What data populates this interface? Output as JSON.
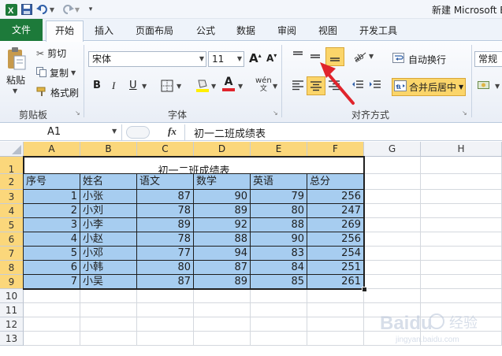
{
  "window": {
    "title": "新建 Microsoft E"
  },
  "tabs": [
    "文件",
    "开始",
    "插入",
    "页面布局",
    "公式",
    "数据",
    "审阅",
    "视图",
    "开发工具"
  ],
  "ribbon": {
    "clipboard": {
      "paste": "粘贴",
      "cut": "剪切",
      "copy": "复制",
      "format_painter": "格式刷",
      "group": "剪贴板"
    },
    "font": {
      "name": "宋体",
      "size": "11",
      "bold": "B",
      "italic": "I",
      "underline": "U",
      "group": "字体",
      "grow": "A",
      "shrink": "A",
      "font_color_glyph": "A",
      "phonetic": "wén"
    },
    "alignment": {
      "wrap": "自动换行",
      "merge": "合并后居中",
      "group": "对齐方式"
    },
    "number": {
      "format": "常规"
    }
  },
  "formula_bar": {
    "name_box": "A1",
    "fx": "fx",
    "content": "初一二班成绩表"
  },
  "columns": [
    "A",
    "B",
    "C",
    "D",
    "E",
    "F",
    "G",
    "H"
  ],
  "rows": [
    "1",
    "2",
    "3",
    "4",
    "5",
    "6",
    "7",
    "8",
    "9",
    "10",
    "11",
    "12",
    "13"
  ],
  "sheet": {
    "title": "初一二班成绩表",
    "headers": [
      "序号",
      "姓名",
      "语文",
      "数学",
      "英语",
      "总分"
    ],
    "data": [
      [
        "1",
        "小张",
        "87",
        "90",
        "79",
        "256"
      ],
      [
        "2",
        "小刘",
        "78",
        "89",
        "80",
        "247"
      ],
      [
        "3",
        "小李",
        "89",
        "92",
        "88",
        "269"
      ],
      [
        "4",
        "小赵",
        "78",
        "88",
        "90",
        "256"
      ],
      [
        "5",
        "小邓",
        "77",
        "94",
        "83",
        "254"
      ],
      [
        "6",
        "小韩",
        "80",
        "87",
        "84",
        "251"
      ],
      [
        "7",
        "小吴",
        "87",
        "89",
        "85",
        "261"
      ]
    ]
  },
  "watermark": {
    "brand": "Baidu",
    "text": "经验",
    "url": "jingyan.baidu.com"
  },
  "colors": {
    "accent_file_tab": "#1d7a3a",
    "selection_header": "#fbd77b",
    "cell_fill": "#a7cdf0",
    "arrow": "#e0242c"
  }
}
